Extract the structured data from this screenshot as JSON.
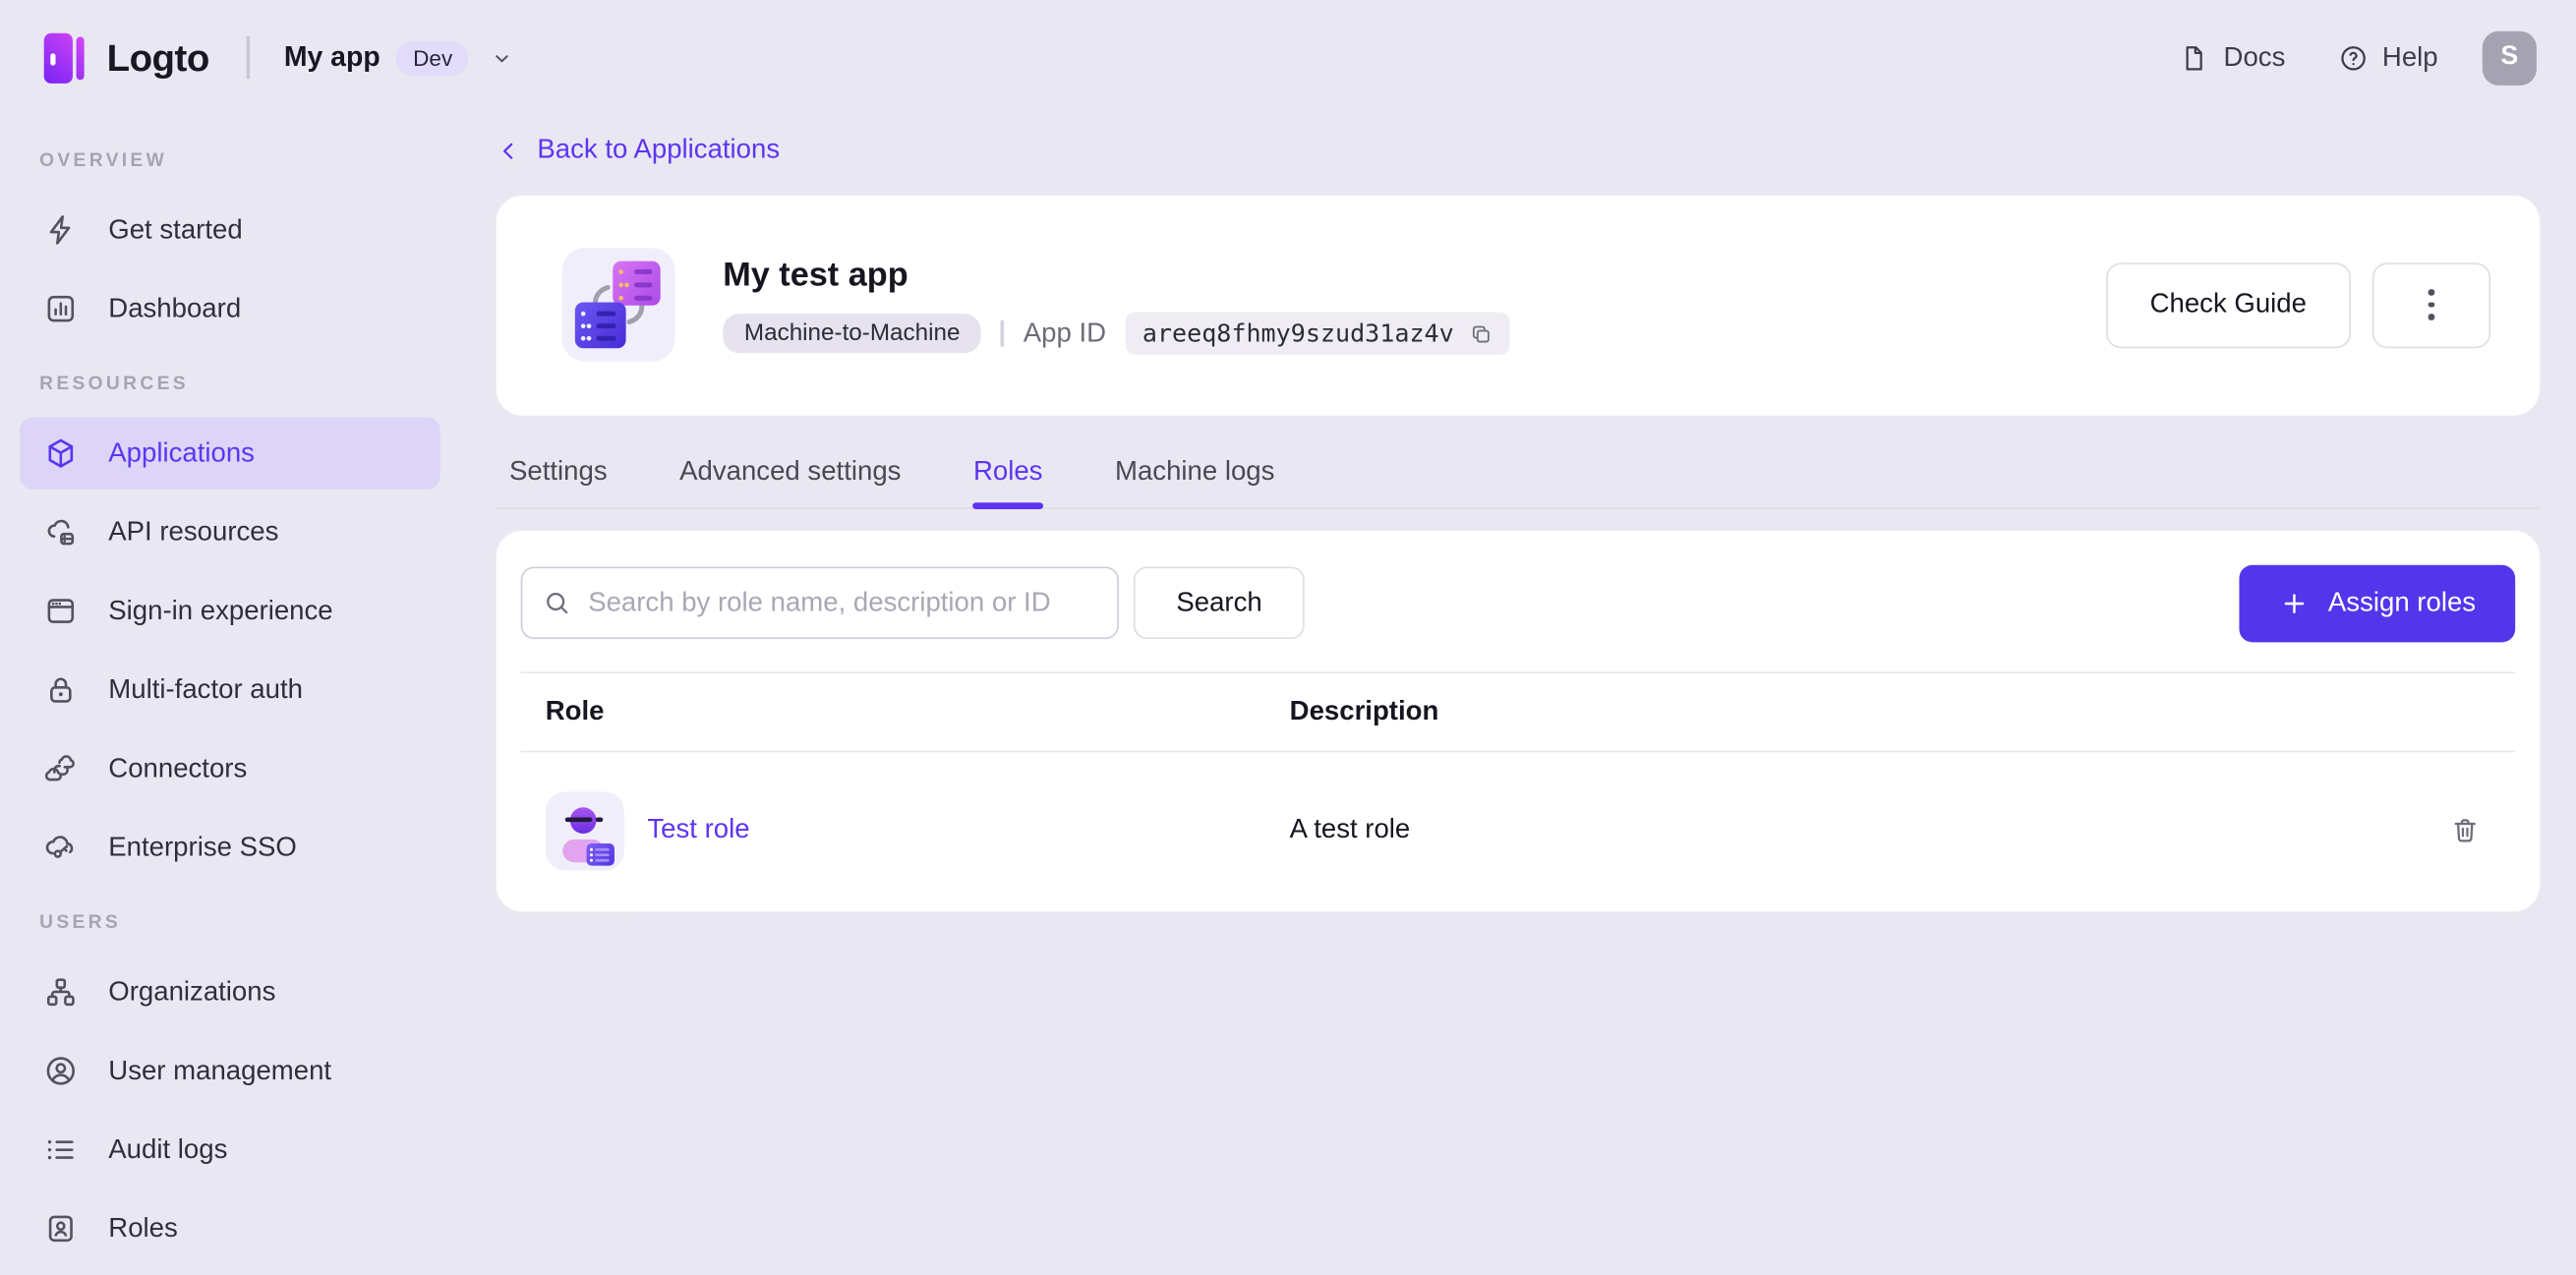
{
  "colors": {
    "accent": "#5D34F2",
    "primary_button": "#5335EB",
    "page_bg": "#E9E8F2",
    "active_nav_bg": "#DCD5F8"
  },
  "topbar": {
    "brand": "Logto",
    "app_switcher": {
      "name": "My app",
      "env_badge": "Dev"
    },
    "docs_label": "Docs",
    "help_label": "Help",
    "avatar_initial": "S"
  },
  "sidebar": {
    "sections": [
      {
        "label": "OVERVIEW",
        "items": [
          {
            "label": "Get started",
            "icon": "lightning-icon"
          },
          {
            "label": "Dashboard",
            "icon": "bar-chart-icon"
          }
        ]
      },
      {
        "label": "RESOURCES",
        "items": [
          {
            "label": "Applications",
            "icon": "cube-icon",
            "active": true
          },
          {
            "label": "API resources",
            "icon": "cloud-box-icon"
          },
          {
            "label": "Sign-in experience",
            "icon": "browser-icon"
          },
          {
            "label": "Multi-factor auth",
            "icon": "lock-icon"
          },
          {
            "label": "Connectors",
            "icon": "clouds-icon"
          },
          {
            "label": "Enterprise SSO",
            "icon": "cloud-key-icon"
          }
        ]
      },
      {
        "label": "USERS",
        "items": [
          {
            "label": "Organizations",
            "icon": "org-chart-icon"
          },
          {
            "label": "User management",
            "icon": "user-circle-icon"
          },
          {
            "label": "Audit logs",
            "icon": "list-icon"
          },
          {
            "label": "Roles",
            "icon": "id-badge-icon"
          }
        ]
      }
    ]
  },
  "main": {
    "back_link": "Back to Applications",
    "app": {
      "title": "My test app",
      "type_badge": "Machine-to-Machine",
      "app_id_label": "App ID",
      "app_id": "areeq8fhmy9szud31az4v"
    },
    "header_actions": {
      "check_guide": "Check Guide"
    },
    "tabs": [
      {
        "label": "Settings"
      },
      {
        "label": "Advanced settings"
      },
      {
        "label": "Roles",
        "active": true
      },
      {
        "label": "Machine logs"
      }
    ],
    "roles_panel": {
      "search_placeholder": "Search by role name, description or ID",
      "search_button": "Search",
      "assign_button": "Assign roles",
      "table": {
        "headers": [
          "Role",
          "Description"
        ],
        "rows": [
          {
            "name": "Test role",
            "description": "A test role"
          }
        ]
      }
    }
  }
}
